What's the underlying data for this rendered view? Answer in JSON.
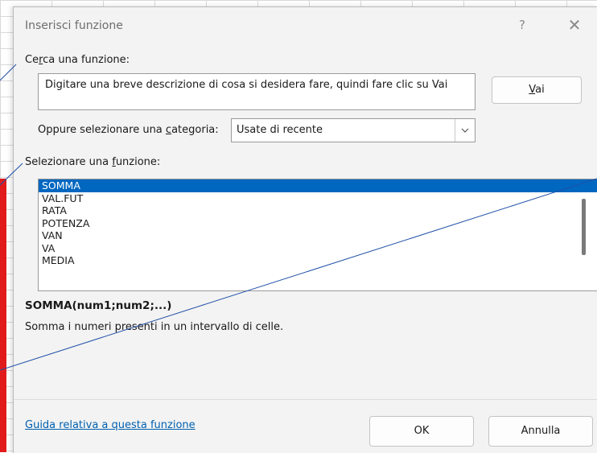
{
  "dialog": {
    "title": "Inserisci funzione",
    "help_glyph": "?",
    "close_glyph": "✕"
  },
  "search": {
    "label_pre": "Ce",
    "label_key": "r",
    "label_post": "ca una funzione:",
    "value": "Digitare una breve descrizione di cosa si desidera fare, quindi fare clic su Vai",
    "button_key": "V",
    "button_rest": "ai"
  },
  "category": {
    "label_pre": "Oppure selezionare una ",
    "label_key": "c",
    "label_post": "ategoria:",
    "selected": "Usate di recente"
  },
  "functions": {
    "label_pre": "Selezionare una ",
    "label_key": "f",
    "label_post": "unzione:",
    "items": [
      "SOMMA",
      "VAL.FUT",
      "RATA",
      "POTENZA",
      "VAN",
      "VA",
      "MEDIA"
    ],
    "selected_index": 0
  },
  "details": {
    "signature": "SOMMA(num1;num2;...)",
    "description": "Somma i numeri presenti in un intervallo di celle."
  },
  "footer": {
    "help_link": "Guida relativa a questa funzione",
    "ok": "OK",
    "cancel": "Annulla"
  },
  "colors": {
    "selection": "#0067c0",
    "link": "#0060b0",
    "annotation_line": "#1f4fa8",
    "red_bar": "#e11b1b"
  }
}
